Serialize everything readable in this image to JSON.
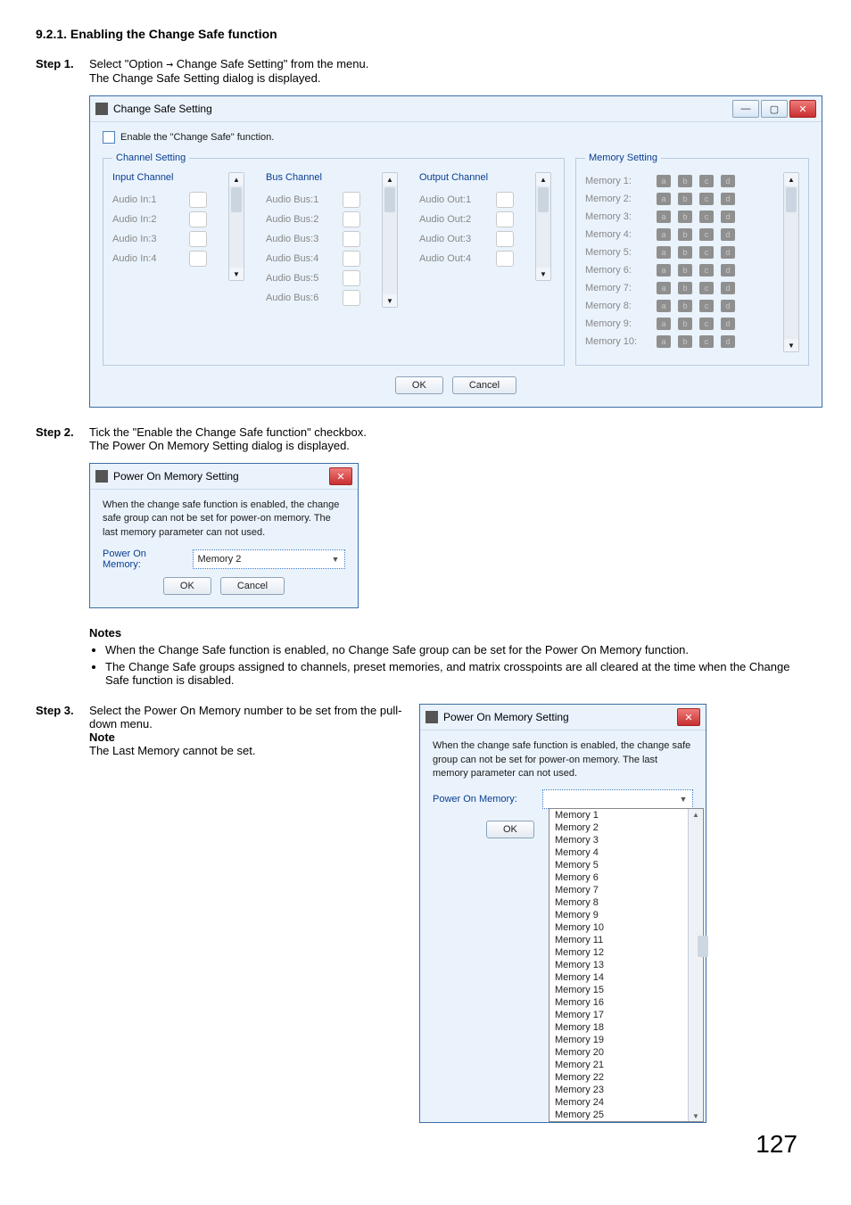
{
  "page": {
    "section_title": "9.2.1. Enabling the Change Safe function",
    "page_number": "127"
  },
  "step1": {
    "label": "Step 1.",
    "line1a": "Select \"Option ",
    "arrow": "→",
    "line1b": " Change Safe Setting\" from the menu.",
    "line2": "The Change Safe Setting dialog is displayed."
  },
  "dlg1": {
    "title": "Change Safe Setting",
    "enable_label": "Enable the \"Change Safe\" function.",
    "channel_setting_legend": "Channel Setting",
    "memory_setting_legend": "Memory Setting",
    "input_header": "Input Channel",
    "bus_header": "Bus Channel",
    "output_header": "Output Channel",
    "inputs": [
      "Audio In:1",
      "Audio In:2",
      "Audio In:3",
      "Audio In:4"
    ],
    "buses": [
      "Audio Bus:1",
      "Audio Bus:2",
      "Audio Bus:3",
      "Audio Bus:4",
      "Audio Bus:5",
      "Audio Bus:6"
    ],
    "outputs": [
      "Audio Out:1",
      "Audio Out:2",
      "Audio Out:3",
      "Audio Out:4"
    ],
    "memories": [
      "Memory 1:",
      "Memory 2:",
      "Memory 3:",
      "Memory 4:",
      "Memory 5:",
      "Memory 6:",
      "Memory 7:",
      "Memory 8:",
      "Memory 9:",
      "Memory 10:"
    ],
    "abcd": [
      "a",
      "b",
      "c",
      "d"
    ],
    "ok": "OK",
    "cancel": "Cancel"
  },
  "step2": {
    "label": "Step 2.",
    "line1": "Tick the \"Enable the Change Safe function\" checkbox.",
    "line2": "The Power On Memory Setting dialog is displayed."
  },
  "dlg2": {
    "title": "Power On Memory Setting",
    "desc": "When the change safe function is enabled, the change safe group can not be set for power-on memory.    The last memory parameter can not used.",
    "pom_label": "Power On Memory:",
    "pom_value": "Memory 2",
    "ok": "OK",
    "cancel": "Cancel"
  },
  "notes": {
    "title": "Notes",
    "items": [
      "When the Change Safe function is enabled, no Change Safe group can be set for the Power On Memory function.",
      "The Change Safe groups assigned to channels, preset memories, and matrix crosspoints are all cleared at the time when the Change Safe function is disabled."
    ]
  },
  "step3": {
    "label": "Step 3.",
    "line1": "Select the Power On Memory number to be set from the pull-down menu.",
    "note_label": "Note",
    "note_text": "The Last Memory cannot be set."
  },
  "dlg3": {
    "title": "Power On Memory Setting",
    "desc": "When the change safe function is enabled, the change safe group can not be set for power-on memory.    The last memory parameter can not used.",
    "pom_label": "Power On Memory:",
    "ok": "OK",
    "options": [
      "Memory 1",
      "Memory 2",
      "Memory 3",
      "Memory 4",
      "Memory 5",
      "Memory 6",
      "Memory 7",
      "Memory 8",
      "Memory 9",
      "Memory 10",
      "Memory 11",
      "Memory 12",
      "Memory 13",
      "Memory 14",
      "Memory 15",
      "Memory 16",
      "Memory 17",
      "Memory 18",
      "Memory 19",
      "Memory 20",
      "Memory 21",
      "Memory 22",
      "Memory 23",
      "Memory 24",
      "Memory 25"
    ]
  }
}
